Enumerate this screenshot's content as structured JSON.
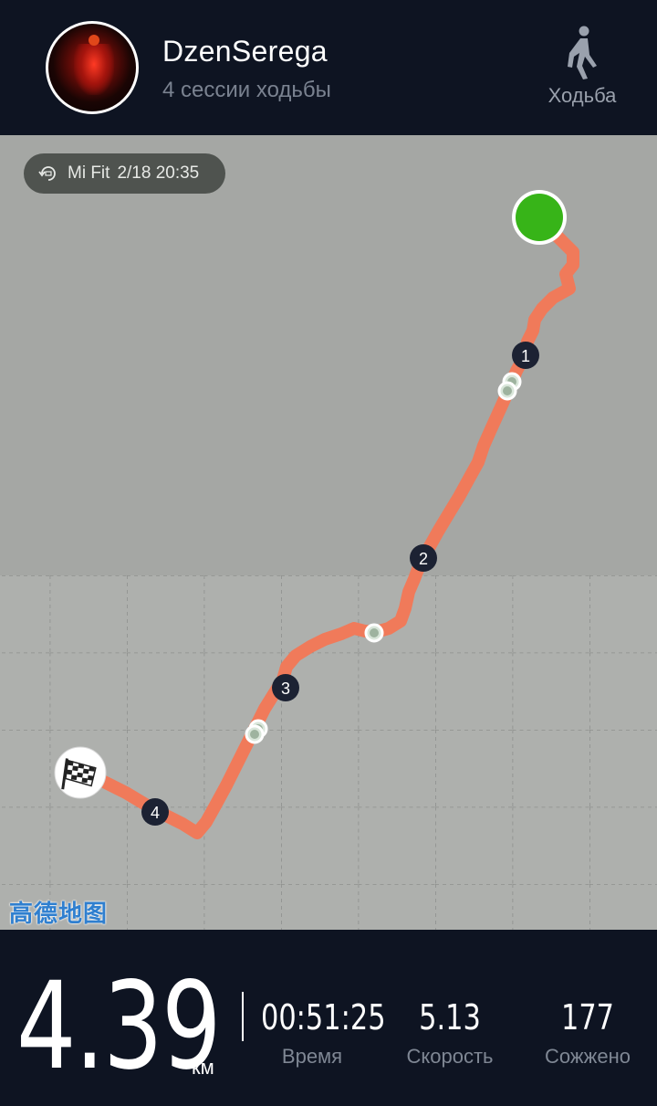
{
  "header": {
    "username": "DzenSerega",
    "subtitle": "4 сессии ходьбы",
    "activity_icon": "walking-person-icon",
    "activity_label": "Ходьба"
  },
  "map": {
    "source_icon": "sync-icon",
    "source": "Mi Fit",
    "datetime": "2/18 20:35",
    "route_color": "#f07a5a",
    "start_color": "#37b418",
    "finish_icon": "checkered-flag-icon",
    "markers": [
      "1",
      "2",
      "3",
      "4"
    ],
    "provider_logo": "高德地图"
  },
  "stats": {
    "distance": "4.39",
    "distance_unit": "км",
    "time_value": "00:51:25",
    "time_label": "Время",
    "speed_value": "5.13",
    "speed_label": "Скорость",
    "calories_value": "177",
    "calories_label": "Сожжено"
  }
}
